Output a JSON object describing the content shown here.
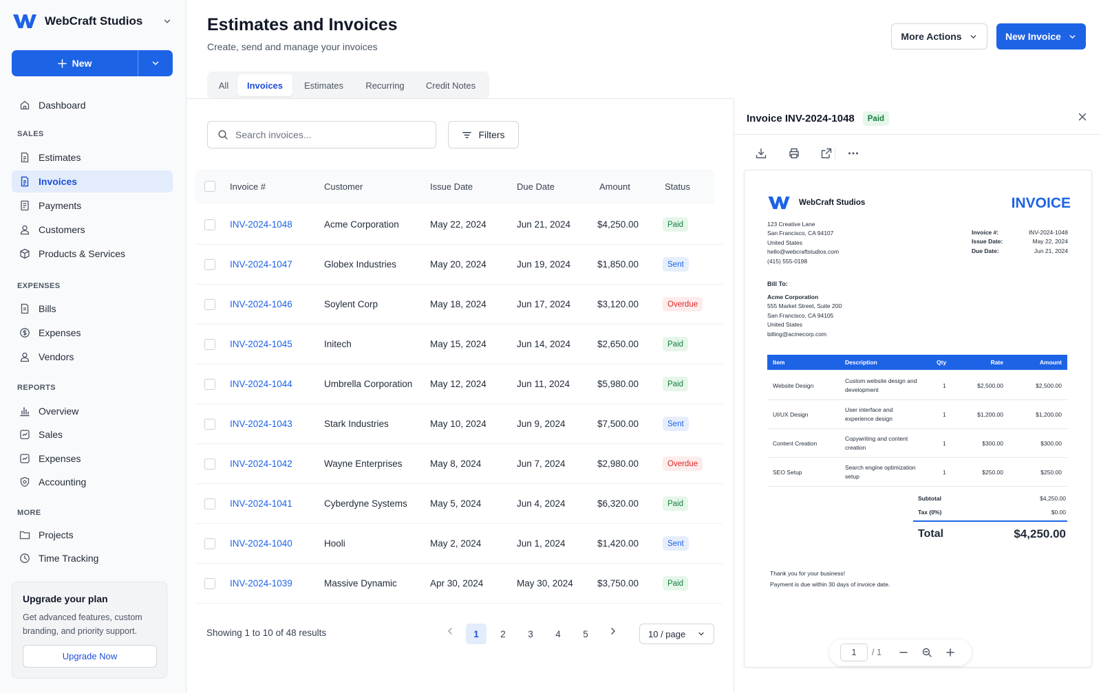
{
  "sidebar": {
    "brand": "WebCraft Studios",
    "new_label": "New",
    "dashboard": "Dashboard",
    "sections": {
      "sales": "SALES",
      "expenses": "EXPENSES",
      "reports": "REPORTS",
      "more": "MORE"
    },
    "sales_items": [
      "Estimates",
      "Invoices",
      "Payments",
      "Customers",
      "Products & Services"
    ],
    "expenses_items": [
      "Bills",
      "Expenses",
      "Vendors"
    ],
    "reports_items": [
      "Overview",
      "Sales",
      "Expenses",
      "Accounting"
    ],
    "more_items": [
      "Projects",
      "Time Tracking"
    ],
    "active_item": "Invoices",
    "upgrade": {
      "title": "Upgrade your plan",
      "text": "Get advanced features, custom branding, and priority support.",
      "button": "Upgrade Now"
    }
  },
  "header": {
    "title": "Estimates and Invoices",
    "subtitle": "Create, send and manage your invoices",
    "more_actions": "More Actions",
    "new_invoice": "New Invoice"
  },
  "tabs": [
    "All",
    "Invoices",
    "Estimates",
    "Recurring",
    "Credit Notes"
  ],
  "active_tab": "Invoices",
  "search": {
    "placeholder": "Search invoices...",
    "value": ""
  },
  "filters_label": "Filters",
  "table": {
    "columns": [
      "Invoice #",
      "Customer",
      "Issue Date",
      "Due Date",
      "Amount",
      "Status"
    ],
    "rows": [
      {
        "invoice": "INV-2024-1048",
        "customer": "Acme Corporation",
        "issue": "May 22, 2024",
        "due": "Jun 21, 2024",
        "amount": "$4,250.00",
        "status": "Paid"
      },
      {
        "invoice": "INV-2024-1047",
        "customer": "Globex Industries",
        "issue": "May 20, 2024",
        "due": "Jun 19, 2024",
        "amount": "$1,850.00",
        "status": "Sent"
      },
      {
        "invoice": "INV-2024-1046",
        "customer": "Soylent Corp",
        "issue": "May 18, 2024",
        "due": "Jun 17, 2024",
        "amount": "$3,120.00",
        "status": "Overdue"
      },
      {
        "invoice": "INV-2024-1045",
        "customer": "Initech",
        "issue": "May 15, 2024",
        "due": "Jun 14, 2024",
        "amount": "$2,650.00",
        "status": "Paid"
      },
      {
        "invoice": "INV-2024-1044",
        "customer": "Umbrella Corporation",
        "issue": "May 12, 2024",
        "due": "Jun 11, 2024",
        "amount": "$5,980.00",
        "status": "Paid"
      },
      {
        "invoice": "INV-2024-1043",
        "customer": "Stark Industries",
        "issue": "May 10, 2024",
        "due": "Jun 9, 2024",
        "amount": "$7,500.00",
        "status": "Sent"
      },
      {
        "invoice": "INV-2024-1042",
        "customer": "Wayne Enterprises",
        "issue": "May 8, 2024",
        "due": "Jun 7, 2024",
        "amount": "$2,980.00",
        "status": "Overdue"
      },
      {
        "invoice": "INV-2024-1041",
        "customer": "Cyberdyne Systems",
        "issue": "May 5, 2024",
        "due": "Jun 4, 2024",
        "amount": "$6,320.00",
        "status": "Paid"
      },
      {
        "invoice": "INV-2024-1040",
        "customer": "Hooli",
        "issue": "May 2, 2024",
        "due": "Jun 1, 2024",
        "amount": "$1,420.00",
        "status": "Sent"
      },
      {
        "invoice": "INV-2024-1039",
        "customer": "Massive Dynamic",
        "issue": "Apr 30, 2024",
        "due": "May 30, 2024",
        "amount": "$3,750.00",
        "status": "Paid"
      }
    ]
  },
  "pagination": {
    "results_text": "Showing 1 to 10 of 48 results",
    "pages": [
      "1",
      "2",
      "3",
      "4",
      "5"
    ],
    "current_page": "1",
    "per_page": "10 / page"
  },
  "preview": {
    "title": "Invoice INV-2024-1048",
    "status": "Paid",
    "document": {
      "company": "WebCraft Studios",
      "heading": "INVOICE",
      "address_lines": [
        "123 Creative Lane",
        "San Francisco, CA 94107",
        "United States",
        "hello@webcraftstudios.com",
        "(415) 555-0198"
      ],
      "meta": [
        {
          "label": "Invoice #:",
          "value": "INV-2024-1048"
        },
        {
          "label": "Issue Date:",
          "value": "May 22, 2024"
        },
        {
          "label": "Due Date:",
          "value": "Jun 21, 2024"
        }
      ],
      "bill_to_label": "Bill To:",
      "bill_to_name": "Acme Corporation",
      "bill_to_lines": [
        "555 Market Street, Suite 200",
        "San Francisco, CA 94105",
        "United States",
        "billing@acmecorp.com"
      ],
      "item_columns": [
        "Item",
        "Description",
        "Qty",
        "Rate",
        "Amount"
      ],
      "items": [
        {
          "item": "Website Design",
          "description": "Custom website design and development",
          "qty": "1",
          "rate": "$2,500.00",
          "amount": "$2,500.00"
        },
        {
          "item": "UI/UX Design",
          "description": "User interface and experience design",
          "qty": "1",
          "rate": "$1,200.00",
          "amount": "$1,200.00"
        },
        {
          "item": "Content Creation",
          "description": "Copywriting and content creation",
          "qty": "1",
          "rate": "$300.00",
          "amount": "$300.00"
        },
        {
          "item": "SEO Setup",
          "description": "Search engine optimization setup",
          "qty": "1",
          "rate": "$250.00",
          "amount": "$250.00"
        }
      ],
      "subtotal_label": "Subtotal",
      "subtotal": "$4,250.00",
      "tax_label": "Tax (0%)",
      "tax": "$0.00",
      "total_label": "Total",
      "total": "$4,250.00",
      "footer_lines": [
        "Thank you for your business!",
        "Payment is due within 30 days of invoice date."
      ]
    },
    "viewer": {
      "page": "1",
      "of": "/ 1"
    }
  },
  "colors": {
    "accent": "#1d63e6",
    "paid": "#15803d",
    "sent": "#1d63e6",
    "overdue": "#dc2626"
  }
}
